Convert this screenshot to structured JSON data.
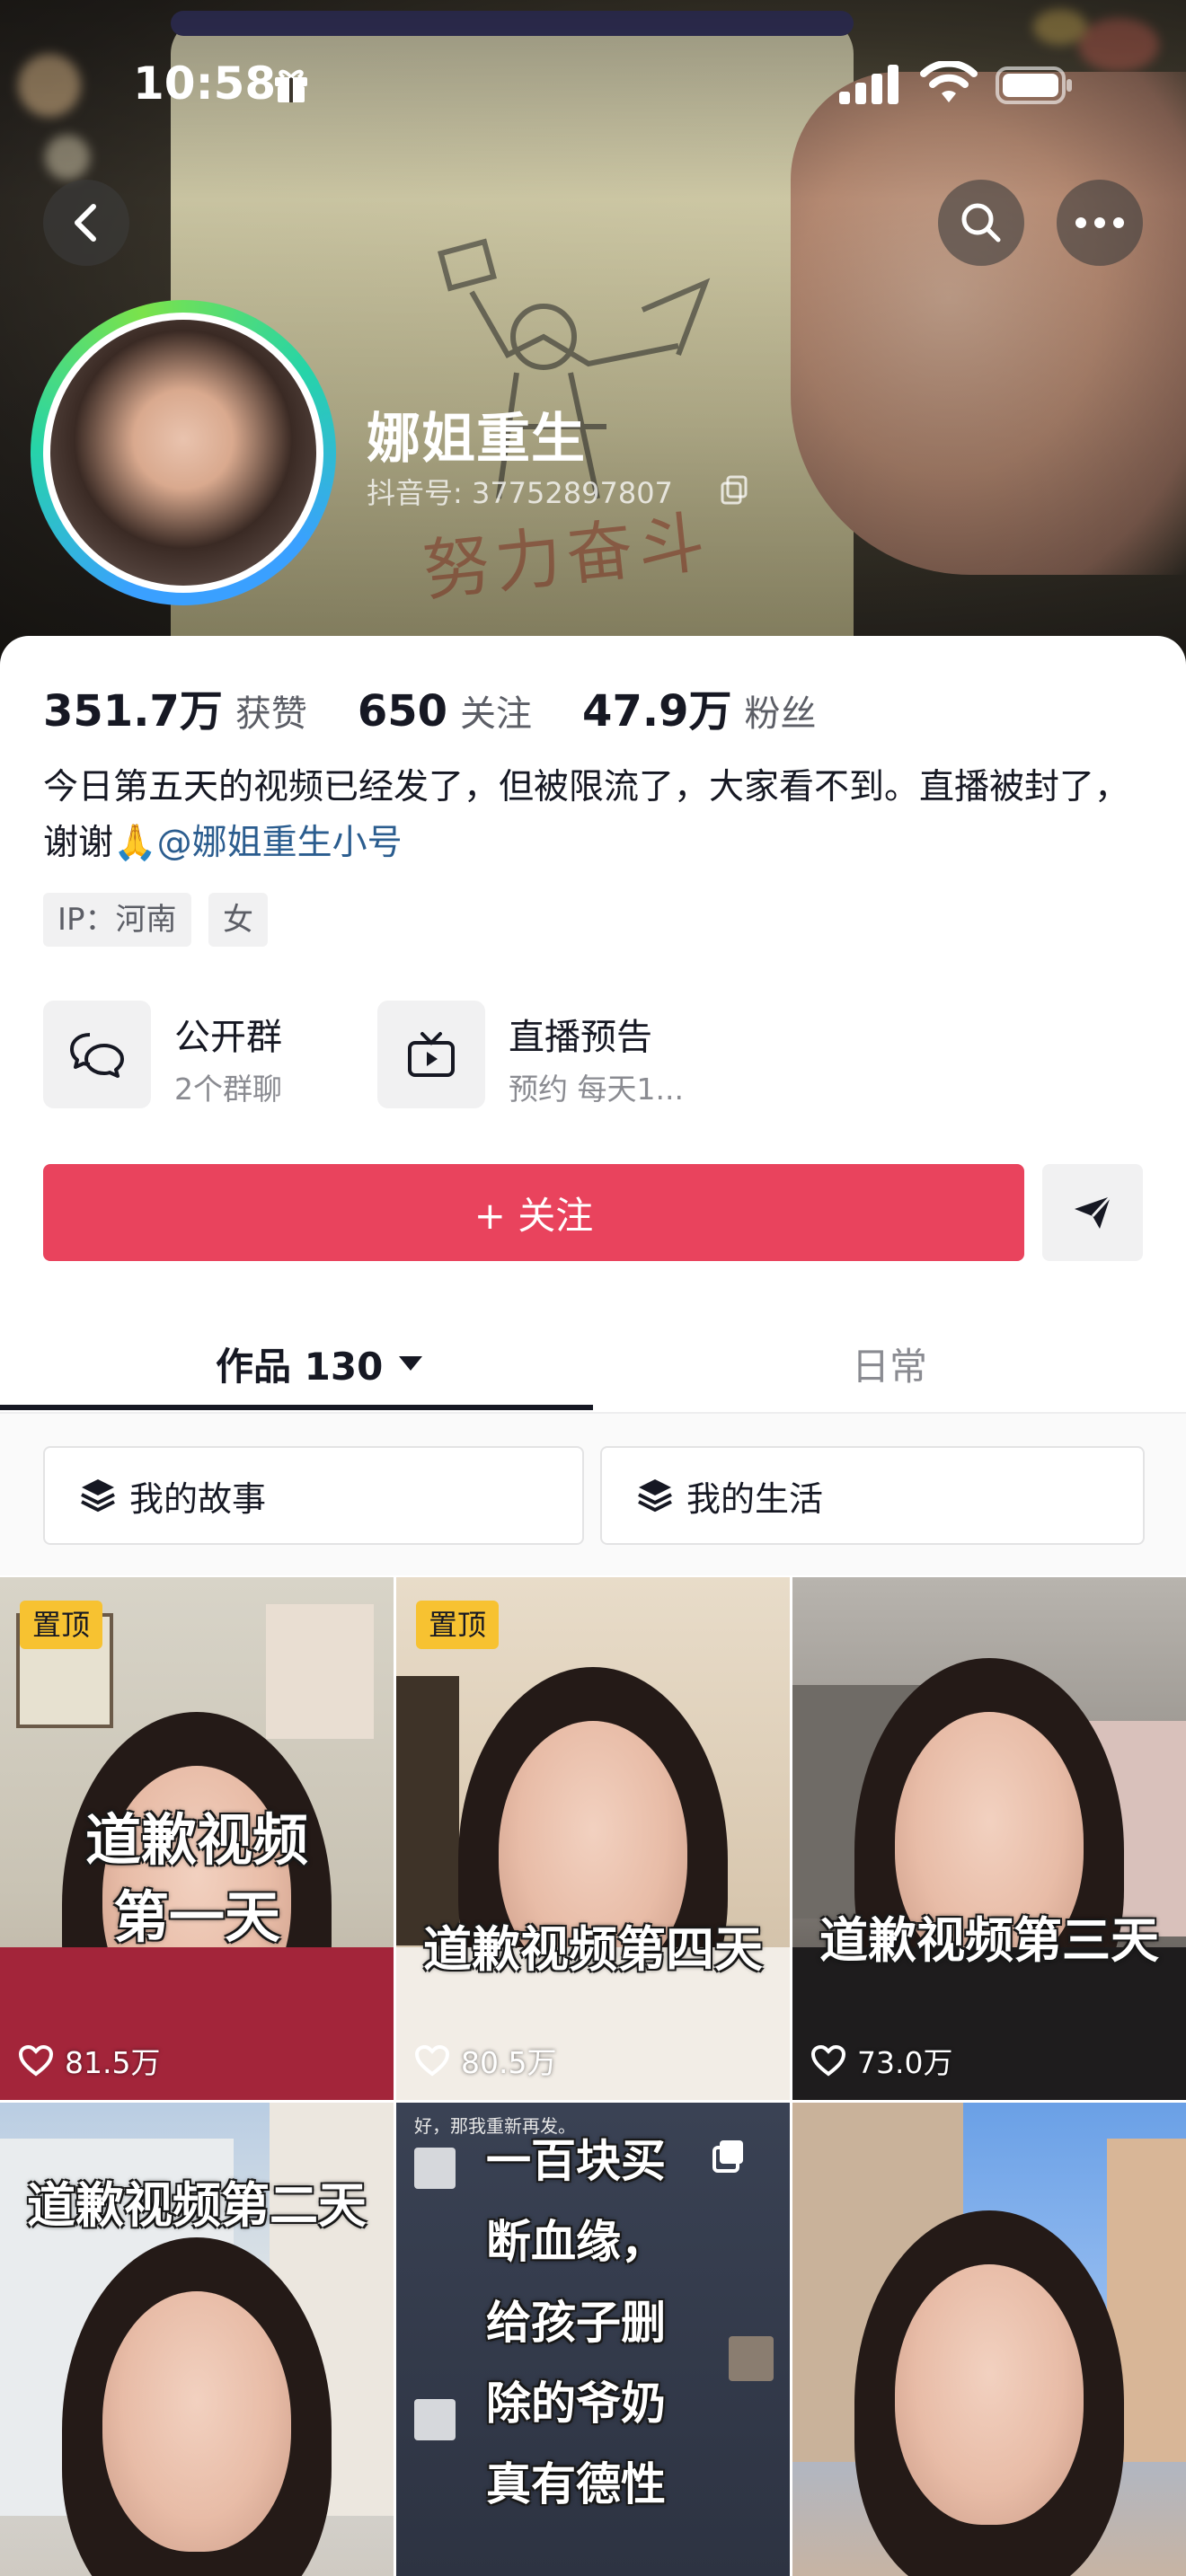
{
  "status_bar": {
    "time": "10:58"
  },
  "profile": {
    "name": "娜姐重生",
    "douyin_id": "抖音号: 37752897807",
    "stats": [
      {
        "value": "351.7万",
        "label": "获赞"
      },
      {
        "value": "650",
        "label": "关注"
      },
      {
        "value": "47.9万",
        "label": "粉丝"
      }
    ],
    "bio": "今日第五天的视频已经发了，但被限流了，大家看不到。直播被封了，谢谢🙏",
    "bio_mention": "@娜姐重生小号",
    "tags": [
      "IP：河南",
      "女"
    ]
  },
  "features": [
    {
      "title": "公开群",
      "subtitle": "2个群聊",
      "icon": "chat-bubbles-icon"
    },
    {
      "title": "直播预告",
      "subtitle": "预约 每天1...",
      "icon": "tv-icon"
    }
  ],
  "actions": {
    "follow_label": "+ 关注"
  },
  "tabs": [
    {
      "label": "作品 130",
      "active": true
    },
    {
      "label": "日常",
      "active": false
    }
  ],
  "collections": [
    {
      "label": "我的故事",
      "icon": "layers-icon"
    },
    {
      "label": "我的生活",
      "icon": "layers-icon"
    }
  ],
  "videos": [
    {
      "pinned": "置顶",
      "title_lines": [
        "道歉视频",
        "第一天"
      ],
      "likes": "81.5万"
    },
    {
      "pinned": "置顶",
      "title_lines": [
        "道歉视频第四天"
      ],
      "likes": "80.5万"
    },
    {
      "pinned": "",
      "title_lines": [
        "道歉视频第三天"
      ],
      "likes": "73.0万"
    },
    {
      "pinned": "",
      "title_lines": [
        "道歉视频第二天"
      ],
      "likes": ""
    },
    {
      "pinned": "",
      "title_lines": [
        "一百块买",
        "断血缘，",
        "给孩子删",
        "除的爷奶",
        "真有德性"
      ],
      "likes": "",
      "caption": "好，那我重新再发。"
    },
    {
      "pinned": "",
      "title_lines": [],
      "likes": ""
    }
  ],
  "colors": {
    "accent": "#e9435d",
    "pin": "#f7c231",
    "mention": "#2b5d8f"
  }
}
